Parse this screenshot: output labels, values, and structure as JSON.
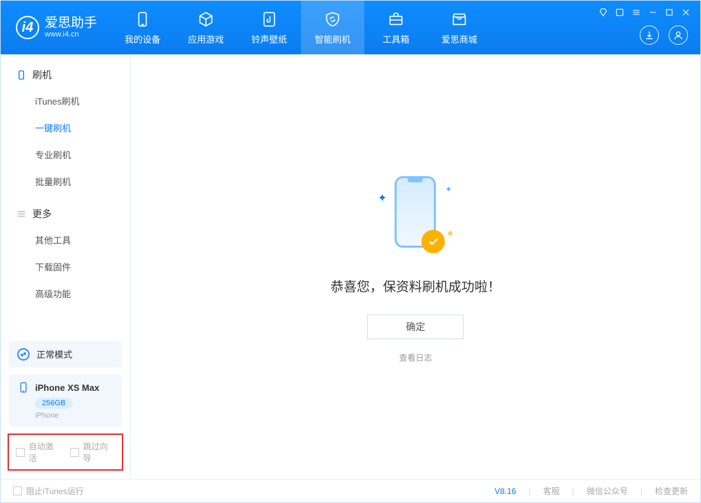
{
  "app": {
    "name_cn": "爱思助手",
    "url": "www.i4.cn"
  },
  "nav": {
    "my_device": "我的设备",
    "apps": "应用游戏",
    "ringtones": "铃声壁纸",
    "flash": "智能刷机",
    "toolbox": "工具箱",
    "store": "爱思商城"
  },
  "sidebar": {
    "group_flash": "刷机",
    "items_flash": {
      "itunes": "iTunes刷机",
      "onekey": "一键刷机",
      "pro": "专业刷机",
      "batch": "批量刷机"
    },
    "group_more": "更多",
    "items_more": {
      "other": "其他工具",
      "download": "下载固件",
      "advanced": "高级功能"
    },
    "mode": "正常模式",
    "device_name": "iPhone XS Max",
    "device_cap": "256GB",
    "device_type": "iPhone",
    "opt_auto_activate": "自动激活",
    "opt_skip_guide": "跳过向导"
  },
  "main": {
    "success": "恭喜您，保资料刷机成功啦！",
    "ok": "确定",
    "view_log": "查看日志"
  },
  "footer": {
    "block_itunes": "阻止iTunes运行",
    "version": "V8.16",
    "kefu": "客服",
    "wechat": "微信公众号",
    "update": "检查更新"
  }
}
